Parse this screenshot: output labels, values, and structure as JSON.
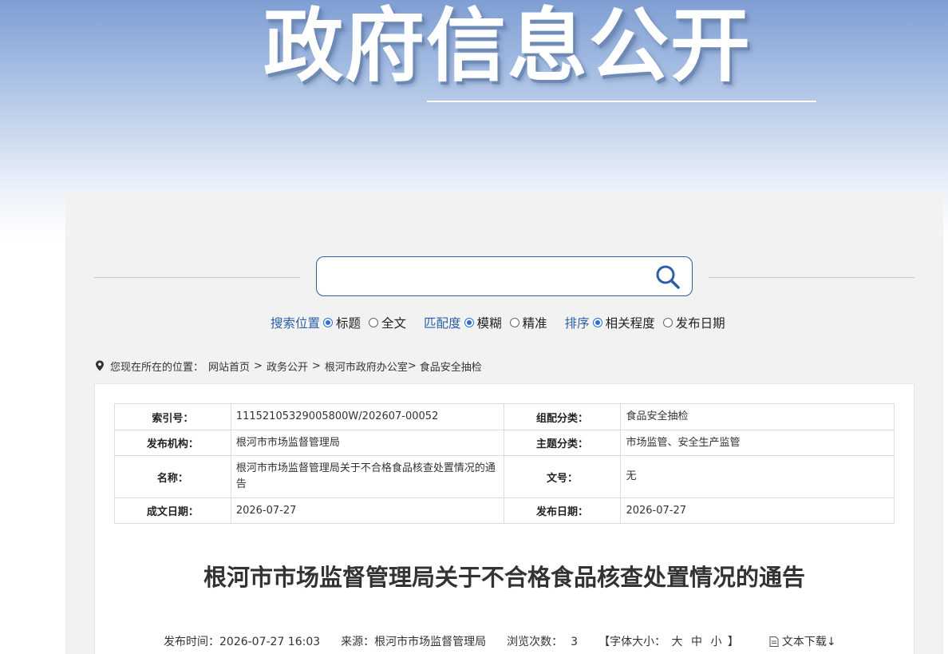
{
  "banner": {
    "title": "政府信息公开"
  },
  "search": {
    "placeholder": "",
    "position_label": "搜索位置",
    "position_options": [
      "标题",
      "全文"
    ],
    "match_label": "匹配度",
    "match_options": [
      "模糊",
      "精准"
    ],
    "sort_label": "排序",
    "sort_options": [
      "相关程度",
      "发布日期"
    ]
  },
  "breadcrumb": {
    "prefix": "您现在所在的位置：",
    "items": [
      "网站首页",
      "政务公开",
      "根河市政府办公室",
      "食品安全抽检"
    ],
    "sep1": ">",
    "sep2": ">",
    "sep3": ">"
  },
  "meta": {
    "index_label": "索引号：",
    "index_value": "11152105329005800W/202607-00052",
    "category_label": "组配分类：",
    "category_value": "食品安全抽检",
    "publisher_label": "发布机构：",
    "publisher_value": "根河市市场监督管理局",
    "topic_label": "主题分类：",
    "topic_value": "市场监管、安全生产监管",
    "name_label": "名称：",
    "name_value": "根河市市场监督管理局关于不合格食品核查处置情况的通告",
    "docno_label": "文号：",
    "docno_value": "无",
    "created_label": "成文日期：",
    "created_value": "2026-07-27",
    "published_label": "发布日期：",
    "published_value": "2026-07-27"
  },
  "article": {
    "title": "根河市市场监督管理局关于不合格食品核查处置情况的通告",
    "publish_time": "发布时间：2026-07-27 16:03",
    "source": "来源：根河市市场监督管理局",
    "views_label": "浏览次数：",
    "views_value": "3",
    "font_size_open": "【字体大小：",
    "font_large": "大",
    "font_medium": "中",
    "font_small": "小",
    "font_size_close": "】",
    "download": "文本下载↓"
  },
  "colors": {
    "accent": "#2d5fa6",
    "radio": "#2b6fd6",
    "panel_bg": "#f2f2f2"
  }
}
